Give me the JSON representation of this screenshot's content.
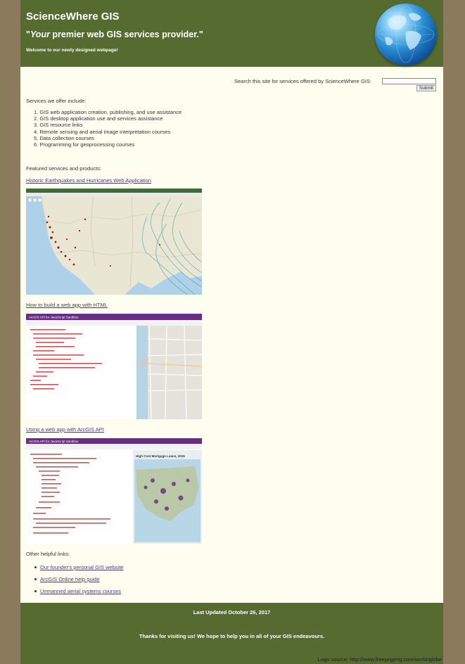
{
  "header": {
    "title": "ScienceWhere GIS",
    "tagline_em": "Your",
    "tagline_rest": " premier web GIS services provider.\"",
    "tagline_open": "\"",
    "welcome": "Welcome to our newly designed webpage!"
  },
  "search": {
    "label": "Search this site for services offered by ScienceWhere GIS:",
    "value": "",
    "placeholder": "",
    "submit_label": "Submit"
  },
  "services": {
    "intro": "Services we offer include:",
    "items": [
      "1. GIS web application creation, publishing, and use assistance",
      "2. GIS desktop application use and services assistance",
      "3. GIS resource links",
      "4. Remote sensing and aerial image interpretation courses",
      "5. Data collection courses",
      "6. Programming for geoprocessing courses"
    ]
  },
  "featured": {
    "intro": "Featured services and products:",
    "items": [
      {
        "link": "Historic Earthquakes and Hurricanes Web Application"
      },
      {
        "link": "How to build a web app with HTML",
        "app_header": "ArcGIS API for JavaScript Sandbox"
      },
      {
        "link": "Using a web app with ArcGIS API",
        "app_header": "ArcGIS API for JavaScript Sandbox",
        "map_title": "High Cost Mortgage Loans, 2015"
      }
    ]
  },
  "helpful": {
    "intro": "Other helpful links:",
    "links": [
      "Our founder's personal GIS website",
      "ArcGIS Online help guide",
      "Unmanned aerial systems courses"
    ]
  },
  "footer": {
    "updated": "Last Updated October 26, 2017",
    "thanks": "Thanks for visiting us! We hope to help you in all of your GIS endeavours.",
    "logo_source": "Logo source: http://www.freepngimg.com/world/globe"
  },
  "colors": {
    "header_bg": "#556b2f",
    "page_bg": "#fdfdf0",
    "outer_bg": "#8b7b5c",
    "link": "#4b3a70"
  }
}
